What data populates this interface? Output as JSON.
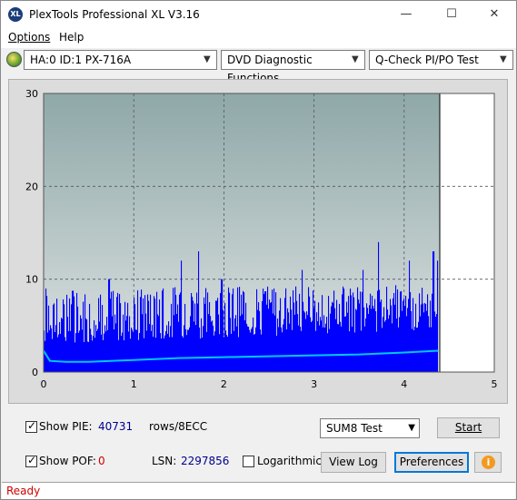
{
  "window": {
    "title": "PlexTools Professional XL V3.16",
    "icon_label": "XL",
    "controls": [
      "minimize-icon",
      "maximize-icon",
      "close-icon"
    ]
  },
  "menu": {
    "options": "Options",
    "help": "Help"
  },
  "toolbar": {
    "drive": "HA:0 ID:1  PX-716A",
    "function": "DVD Diagnostic Functions",
    "test": "Q-Check PI/PO Test"
  },
  "colors": {
    "plot_bg_top": "#8fa8a8",
    "plot_bg_bottom": "#e0e4e4",
    "pie_bars": "#0000ff",
    "trend_line": "#00c8ff",
    "status_text": "#d00000",
    "accent": "#0078d7"
  },
  "chart_data": {
    "type": "bar",
    "x_ticks": [
      "0",
      "1",
      "2",
      "3",
      "4",
      "5"
    ],
    "y_ticks": [
      "0",
      "10",
      "20",
      "30"
    ],
    "xlim": [
      0,
      5
    ],
    "ylim": [
      0,
      30
    ],
    "data_end_x": 4.38,
    "grid": true,
    "series": [
      {
        "kind": "pie_bars",
        "baseline_range": [
          3,
          6
        ],
        "typical_peak": 8,
        "spikes": [
          {
            "x": 0.02,
            "y": 9
          },
          {
            "x": 0.72,
            "y": 10
          },
          {
            "x": 1.32,
            "y": 9
          },
          {
            "x": 1.52,
            "y": 12
          },
          {
            "x": 1.71,
            "y": 13
          },
          {
            "x": 1.97,
            "y": 10
          },
          {
            "x": 2.55,
            "y": 9
          },
          {
            "x": 2.86,
            "y": 11
          },
          {
            "x": 3.54,
            "y": 11
          },
          {
            "x": 3.71,
            "y": 14
          },
          {
            "x": 4.05,
            "y": 12
          },
          {
            "x": 4.32,
            "y": 13
          },
          {
            "x": 4.37,
            "y": 12
          }
        ]
      },
      {
        "kind": "trend_line",
        "points": [
          [
            0.0,
            2.3
          ],
          [
            0.07,
            1.2
          ],
          [
            0.25,
            1.1
          ],
          [
            0.5,
            1.1
          ],
          [
            1.0,
            1.3
          ],
          [
            1.5,
            1.5
          ],
          [
            2.0,
            1.6
          ],
          [
            2.5,
            1.7
          ],
          [
            3.0,
            1.8
          ],
          [
            3.5,
            1.9
          ],
          [
            4.0,
            2.1
          ],
          [
            4.38,
            2.3
          ]
        ]
      }
    ]
  },
  "panel": {
    "show_pie_label": "Show PIE:",
    "pie_value": "40731",
    "rows_label": "rows/8ECC",
    "sum_test": "SUM8 Test",
    "start": "Start",
    "show_pof_label": "Show POF:",
    "pof_value": "0",
    "lsn_label": "LSN:",
    "lsn_value": "2297856",
    "logarithmic": "Logarithmic",
    "view_log": "View Log",
    "preferences": "Preferences",
    "info_glyph": "i"
  },
  "status": {
    "text": "Ready"
  }
}
